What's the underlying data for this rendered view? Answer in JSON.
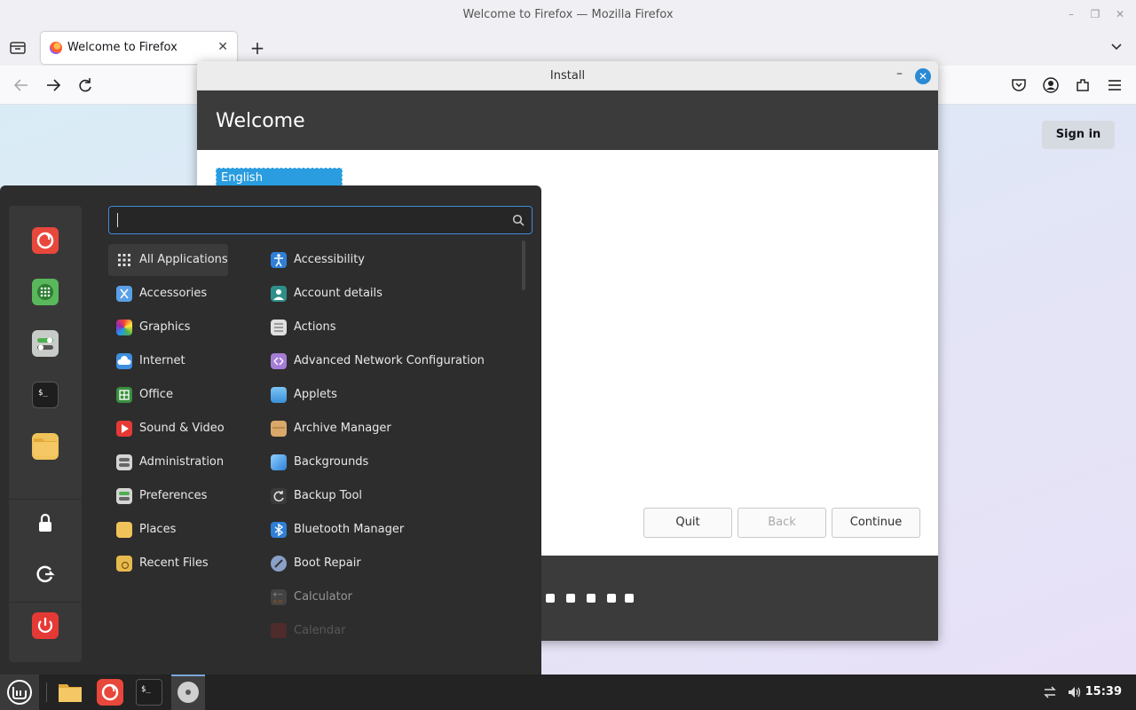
{
  "firefox": {
    "window_title": "Welcome to Firefox — Mozilla Firefox",
    "tab_label": "Welcome to Firefox",
    "sign_in_label": "Sign in"
  },
  "installer": {
    "window_title": "Install",
    "heading": "Welcome",
    "selected_language": "English",
    "buttons": {
      "quit": "Quit",
      "back": "Back",
      "continue": "Continue"
    }
  },
  "menu": {
    "search": {
      "value": "",
      "placeholder": ""
    },
    "categories": [
      {
        "label": "All Applications",
        "icon": "grid-icon",
        "active": true
      },
      {
        "label": "Accessories",
        "icon": "accessories-icon"
      },
      {
        "label": "Graphics",
        "icon": "graphics-icon"
      },
      {
        "label": "Internet",
        "icon": "internet-cloud-icon"
      },
      {
        "label": "Office",
        "icon": "office-icon"
      },
      {
        "label": "Sound & Video",
        "icon": "play-icon"
      },
      {
        "label": "Administration",
        "icon": "administration-icon"
      },
      {
        "label": "Preferences",
        "icon": "preferences-icon"
      },
      {
        "label": "Places",
        "icon": "folder-icon"
      },
      {
        "label": "Recent Files",
        "icon": "recent-files-icon"
      }
    ],
    "apps": [
      {
        "label": "Accessibility",
        "icon": "accessibility-icon"
      },
      {
        "label": "Account details",
        "icon": "account-icon"
      },
      {
        "label": "Actions",
        "icon": "actions-icon"
      },
      {
        "label": "Advanced Network Configuration",
        "icon": "network-icon"
      },
      {
        "label": "Applets",
        "icon": "applets-icon"
      },
      {
        "label": "Archive Manager",
        "icon": "archive-icon"
      },
      {
        "label": "Backgrounds",
        "icon": "backgrounds-icon"
      },
      {
        "label": "Backup Tool",
        "icon": "backup-icon"
      },
      {
        "label": "Bluetooth Manager",
        "icon": "bluetooth-icon"
      },
      {
        "label": "Boot Repair",
        "icon": "boot-repair-icon"
      },
      {
        "label": "Calculator",
        "icon": "calculator-icon"
      },
      {
        "label": "Calendar",
        "icon": "calendar-icon"
      }
    ],
    "favorites": [
      "firefox-icon",
      "software-manager-icon",
      "settings-icon",
      "terminal-icon",
      "files-folder-icon"
    ],
    "session": [
      "lock-icon",
      "logout-icon",
      "power-icon"
    ]
  },
  "taskbar": {
    "clock": "15:39",
    "items": [
      "mint-menu-icon",
      "files-folder-icon",
      "firefox-icon",
      "terminal-icon",
      "installer-disc-icon"
    ]
  },
  "colors": {
    "accent_blue": "#3f8bd6",
    "menu_bg": "#2d2d2d",
    "installer_header": "#3b3b3b",
    "language_highlight": "#2a9de0"
  }
}
